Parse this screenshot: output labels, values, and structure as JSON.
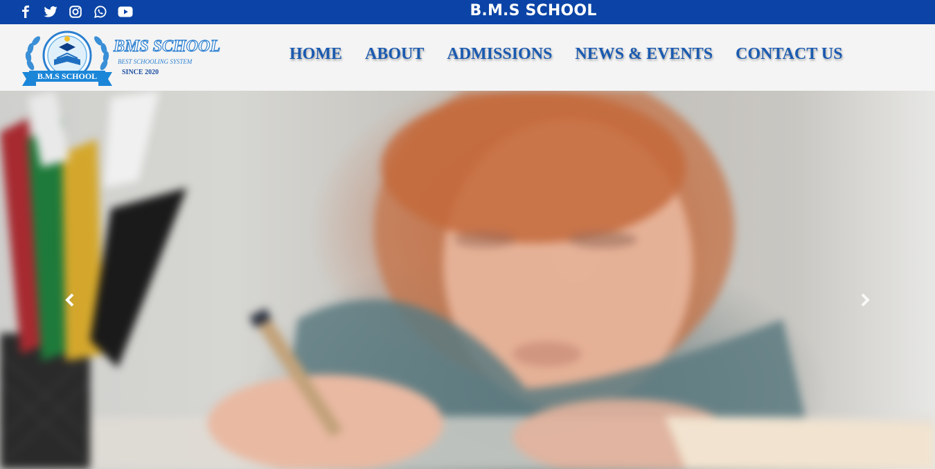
{
  "topbar": {
    "social": [
      {
        "icon": "facebook-icon"
      },
      {
        "icon": "twitter-icon"
      },
      {
        "icon": "instagram-icon"
      },
      {
        "icon": "whatsapp-icon"
      },
      {
        "icon": "youtube-icon"
      }
    ],
    "brand": "B.M.S SCHOOL",
    "background_color": "#0b44a6"
  },
  "header": {
    "logo": {
      "name": "BMS SCHOOL",
      "tagline": "BEST SCHOOLING SYSTEM",
      "since": "SINCE 2020",
      "ribbon": "B.M.S SCHOOL"
    },
    "nav": [
      {
        "label": "HOME"
      },
      {
        "label": "ABOUT"
      },
      {
        "label": "ADMISSIONS"
      },
      {
        "label": "NEWS & EVENTS"
      },
      {
        "label": "CONTACT US"
      }
    ],
    "nav_color": "#1a5ab0"
  },
  "hero": {
    "image": "girl-writing-with-pencil-photo",
    "prev_icon": "chevron-left-icon",
    "next_icon": "chevron-right-icon"
  }
}
